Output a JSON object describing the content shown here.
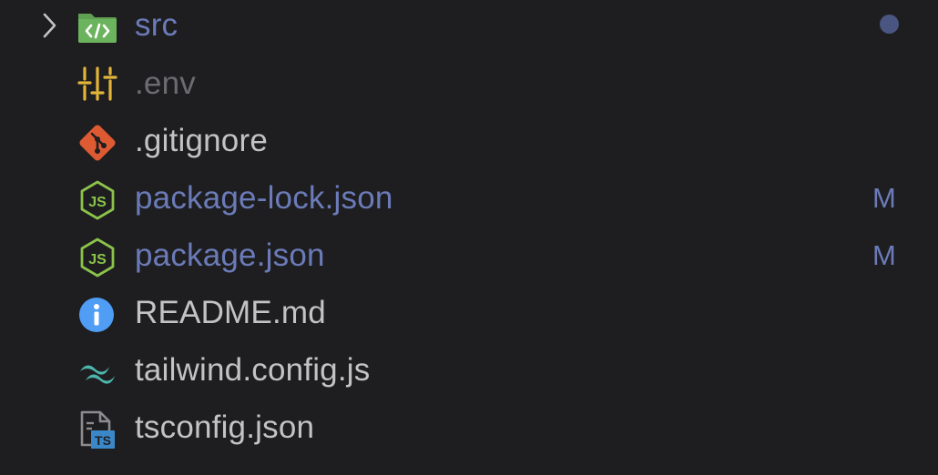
{
  "explorer": {
    "items": [
      {
        "label": "src",
        "kind": "folder",
        "icon": "folder-src-icon",
        "status": "modified",
        "badge": "",
        "collapsed": true,
        "has_dot": true
      },
      {
        "label": ".env",
        "kind": "file",
        "icon": "env-settings-icon",
        "status": "ignored",
        "badge": ""
      },
      {
        "label": ".gitignore",
        "kind": "file",
        "icon": "git-icon",
        "status": "normal",
        "badge": ""
      },
      {
        "label": "package-lock.json",
        "kind": "file",
        "icon": "nodejs-icon",
        "status": "modified",
        "badge": "M"
      },
      {
        "label": "package.json",
        "kind": "file",
        "icon": "nodejs-icon",
        "status": "modified",
        "badge": "M"
      },
      {
        "label": "README.md",
        "kind": "file",
        "icon": "info-icon",
        "status": "normal",
        "badge": ""
      },
      {
        "label": "tailwind.config.js",
        "kind": "file",
        "icon": "tailwind-icon",
        "status": "normal",
        "badge": ""
      },
      {
        "label": "tsconfig.json",
        "kind": "file",
        "icon": "tsconfig-icon",
        "status": "normal",
        "badge": ""
      }
    ]
  },
  "colors": {
    "background": "#1e1e20",
    "modified_text": "#6b7bb8",
    "normal_text": "#c3c3c6",
    "ignored_text": "#6c6c70",
    "folder_green": "#5fa052",
    "env_yellow": "#e2b53a",
    "git_orange": "#de5a33",
    "node_green": "#8bc34a",
    "info_blue": "#4f9df5",
    "tailwind_teal": "#4db6ac",
    "ts_blue": "#3b88c8"
  }
}
